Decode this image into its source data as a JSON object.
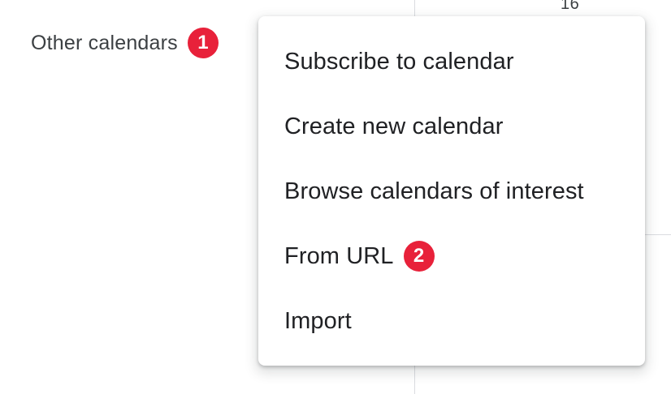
{
  "background": {
    "day_number": "16"
  },
  "sidebar": {
    "other_calendars_label": "Other calendars",
    "step_badge": "1"
  },
  "menu": {
    "items": [
      {
        "label": "Subscribe to calendar"
      },
      {
        "label": "Create new calendar"
      },
      {
        "label": "Browse calendars of interest"
      },
      {
        "label": "From URL",
        "step_badge": "2"
      },
      {
        "label": "Import"
      }
    ]
  },
  "colors": {
    "badge": "#e8213a",
    "text": "#202124",
    "grid_line": "#dadce0"
  }
}
